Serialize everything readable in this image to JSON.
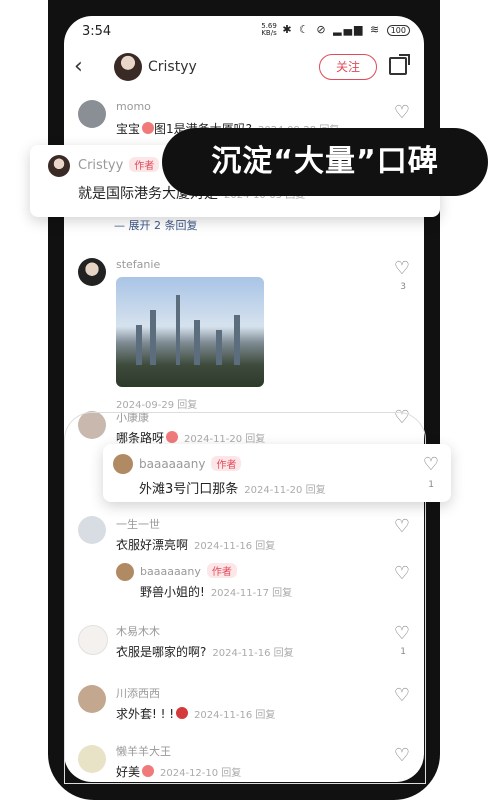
{
  "status": {
    "time": "3:54",
    "speed_top": "5.69",
    "speed_bottom": "KB/s",
    "battery": "100"
  },
  "header": {
    "title": "Cristyy",
    "follow_label": "关注"
  },
  "comments": [
    {
      "name": "momo",
      "text": "宝宝",
      "text2": "图1是港务大厦吗?",
      "meta": "2024-09-28  回复"
    },
    {
      "name": "stefanie",
      "meta": "2024-09-29   回复",
      "likes": "3"
    },
    {
      "name": "小康康",
      "text": "哪条路呀",
      "meta": "2024-11-20   回复"
    },
    {
      "name": "一生一世",
      "text": "衣服好漂亮啊",
      "meta": "2024-11-16   回复"
    },
    {
      "name": "baaaaaany",
      "badge": "作者",
      "text": "野兽小姐的!",
      "meta": "2024-11-17   回复"
    },
    {
      "name": "木易木木",
      "text": "衣服是哪家的啊?",
      "meta": "2024-11-16   回复",
      "likes": "1"
    },
    {
      "name": "川添西西",
      "text": "求外套! ! !",
      "meta": "2024-11-16   回复"
    },
    {
      "name": "懒羊羊大王",
      "text": "好美",
      "meta": "2024-12-10   回复"
    }
  ],
  "expand_label": "— 展开 2 条回复",
  "popup1": {
    "name": "Cristyy",
    "badge": "作者",
    "text": "就是国际港务大厦对是",
    "meta": "2024-10-05  回复"
  },
  "popup2": {
    "name": "baaaaaany",
    "badge": "作者",
    "text": "外滩3号门口那条",
    "meta": "2024-11-20   回复",
    "likes": "1"
  },
  "banner": {
    "text": "沉淀“大量”口碑"
  },
  "icons": {
    "back": "chevron-left-icon",
    "share": "share-icon",
    "like": "heart-icon"
  },
  "colors": {
    "accent": "#e14a5a",
    "banner_bg": "#111111"
  }
}
